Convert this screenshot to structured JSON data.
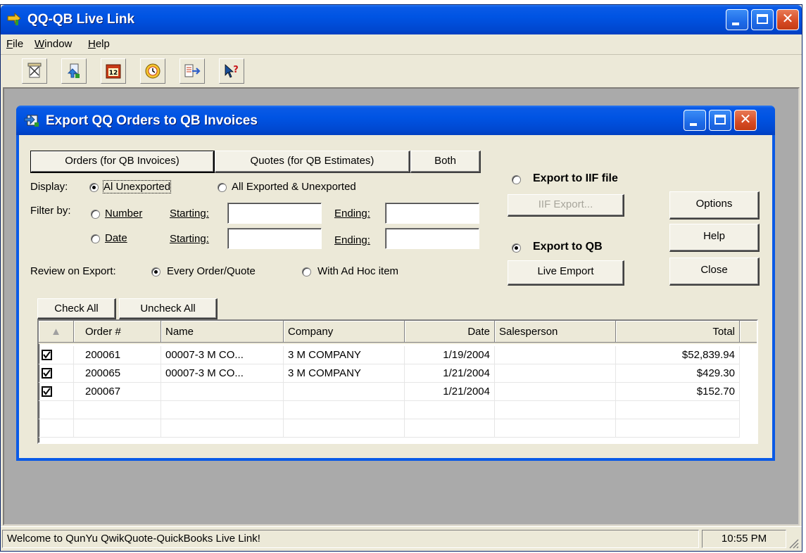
{
  "app": {
    "title": "QQ-QB Live Link",
    "menu": [
      "File",
      "Window",
      "Help"
    ]
  },
  "toolbar": {
    "buttons": [
      "export-icon",
      "import-icon",
      "calendar-icon",
      "clock-icon",
      "transfer-icon",
      "help-arrow-icon"
    ]
  },
  "dialog": {
    "title": "Export QQ Orders to QB Invoices",
    "tabs": {
      "orders": "Orders (for QB Invoices)",
      "quotes": "Quotes (for QB Estimates)",
      "both": "Both"
    },
    "display": {
      "label": "Display:",
      "opt_unexported": "Al Unexported",
      "opt_all": "All Exported & Unexported"
    },
    "filter": {
      "label": "Filter by:",
      "number": "Number",
      "date": "Date",
      "starting": "Starting:",
      "ending": "Ending:"
    },
    "review": {
      "label": "Review on Export:",
      "opt_every": "Every Order/Quote",
      "opt_adhoc": "With Ad Hoc item"
    },
    "export": {
      "iif_label": "Export to IIF file",
      "iif_button": "IIF Export...",
      "qb_label": "Export to QB",
      "live_button": "Live Emport"
    },
    "buttons": {
      "options": "Options",
      "help": "Help",
      "close": "Close",
      "check_all": "Check All",
      "uncheck_all": "Uncheck All"
    },
    "grid": {
      "columns": [
        "Order #",
        "Name",
        "Company",
        "Date",
        "Salesperson",
        "Total"
      ],
      "rows": [
        {
          "order": "200061",
          "name": "00007-3 M CO...",
          "company": "3 M COMPANY",
          "date": "1/19/2004",
          "salesperson": "",
          "total": "$52,839.94"
        },
        {
          "order": "200065",
          "name": "00007-3 M CO...",
          "company": "3 M COMPANY",
          "date": "1/21/2004",
          "salesperson": "",
          "total": "$429.30"
        },
        {
          "order": "200067",
          "name": "",
          "company": "",
          "date": "1/21/2004",
          "salesperson": "",
          "total": "$152.70"
        }
      ]
    }
  },
  "status": {
    "message": "Welcome to QunYu QwikQuote-QuickBooks Live Link!",
    "time": "10:55 PM"
  },
  "colors": {
    "titlebar": "#0054e3",
    "close_button": "#d64a23",
    "face": "#ece9d8",
    "mdi_background": "#aaaaaa"
  }
}
